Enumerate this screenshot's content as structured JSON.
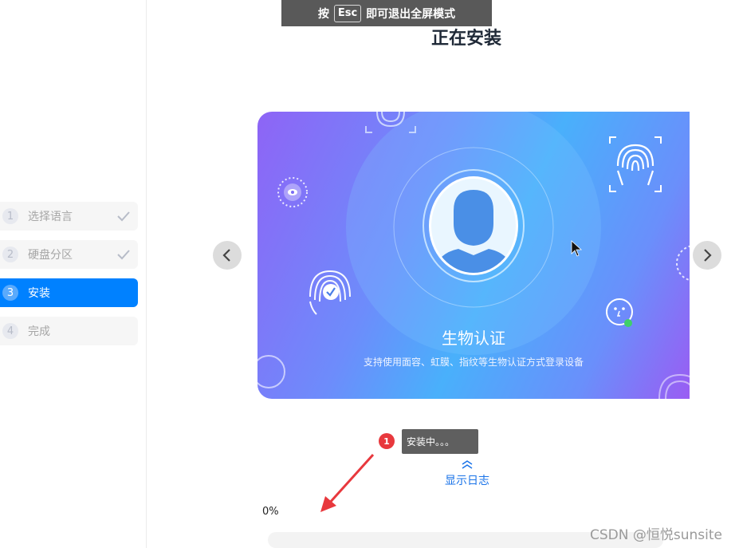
{
  "steps": [
    {
      "num": "1",
      "label": "选择语言",
      "done": true
    },
    {
      "num": "2",
      "label": "硬盘分区",
      "done": true
    },
    {
      "num": "3",
      "label": "安装",
      "active": true
    },
    {
      "num": "4",
      "label": "完成"
    }
  ],
  "banner": {
    "prefix": "按",
    "key": "Esc",
    "suffix": "即可退出全屏模式"
  },
  "page_title": "正在安装",
  "slide": {
    "title": "生物认证",
    "subtitle": "支持使用面容、虹膜、指纹等生物认证方式登录设备"
  },
  "status": {
    "badge": "1",
    "tooltip": "安装中。。。",
    "log_toggle": "显示日志",
    "percent_label": "0%",
    "progress": 0
  },
  "watermark": "CSDN @恒悦sunsite",
  "colors": {
    "accent": "#0081ff",
    "badge": "#e8383d",
    "link": "#1a73e8"
  }
}
